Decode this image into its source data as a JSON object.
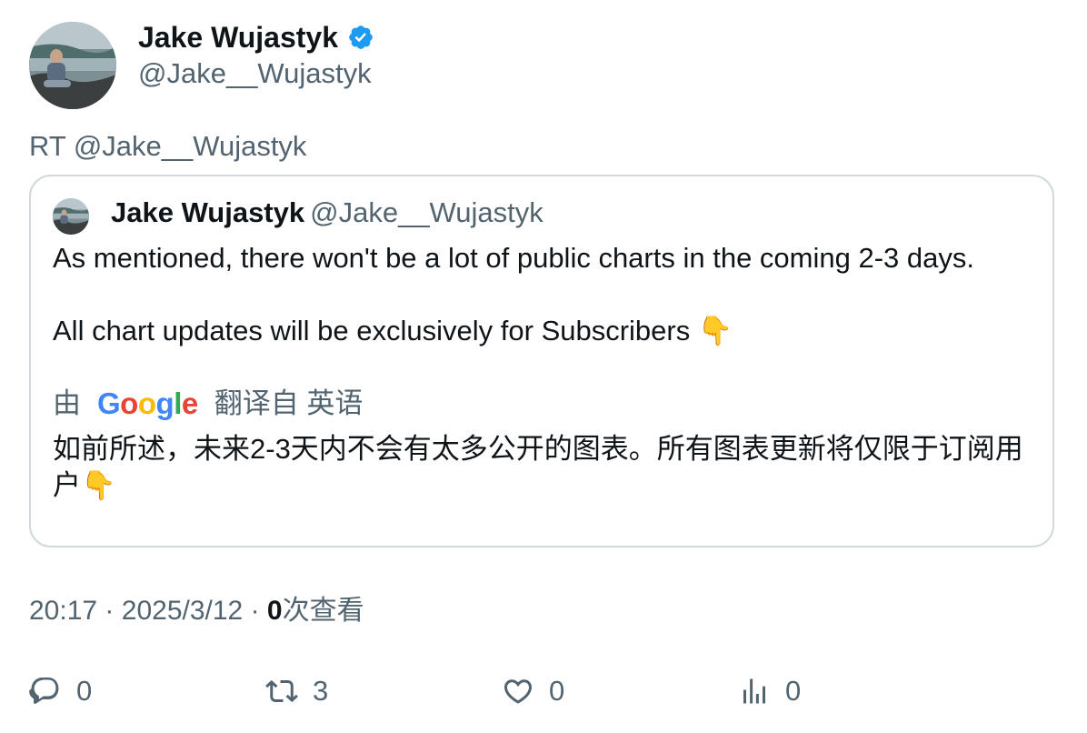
{
  "author": {
    "name": "Jake Wujastyk",
    "handle": "@Jake__Wujastyk",
    "verified": true
  },
  "retweet_text": "RT @Jake__Wujastyk",
  "quoted": {
    "name": "Jake Wujastyk",
    "handle": "@Jake__Wujastyk",
    "text_line1": "As mentioned, there won't be a lot of public charts in the coming 2-3 days.",
    "text_line2": "All chart updates will be exclusively for Subscribers",
    "emoji": "👇",
    "translated_prefix": "由",
    "translator": "Google",
    "translated_suffix": "翻译自 英语",
    "translation": "如前所述，未来2-3天内不会有太多公开的图表。所有图表更新将仅限于订阅用户👇"
  },
  "meta": {
    "time": "20:17",
    "sep1": "·",
    "date": "2025/3/12",
    "sep2": "·",
    "views_count": "0",
    "views_label": "次查看"
  },
  "actions": {
    "reply_count": "0",
    "retweet_count": "3",
    "like_count": "0",
    "views_count": "0"
  },
  "colors": {
    "text": "#0f1419",
    "muted": "#536471",
    "border": "#cfd9de",
    "verified": "#1d9bf0"
  }
}
